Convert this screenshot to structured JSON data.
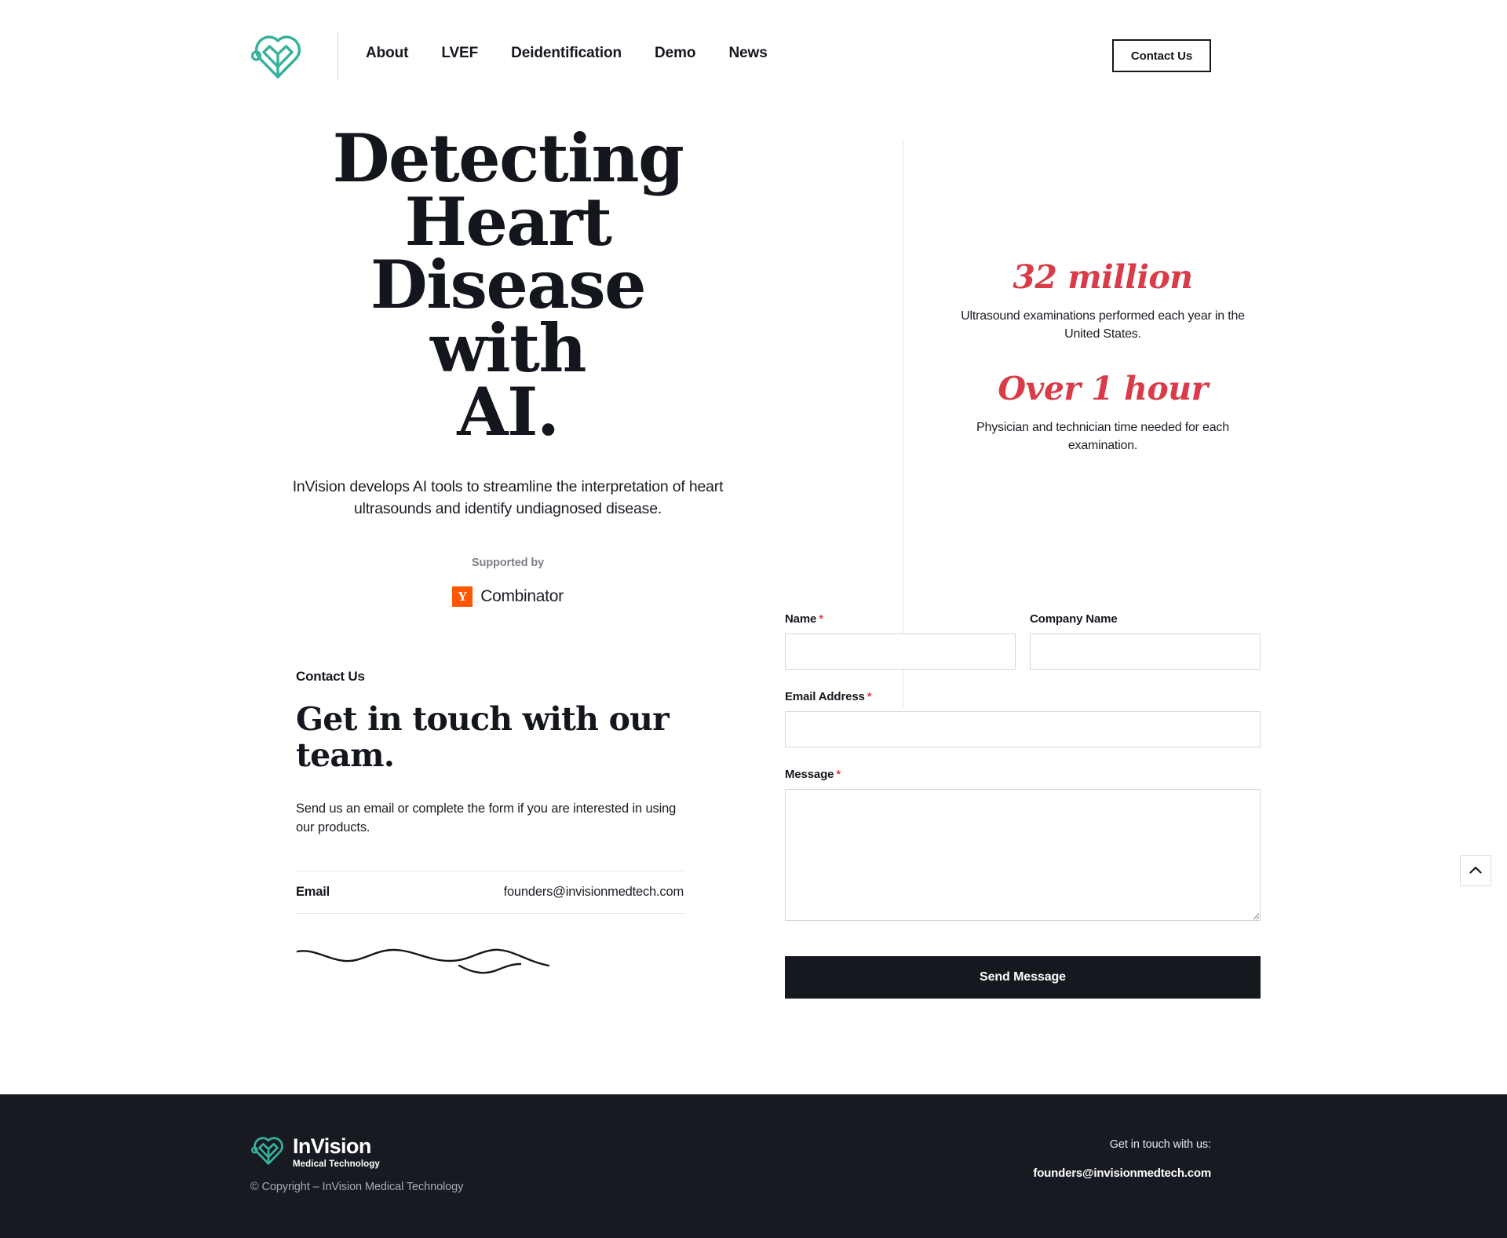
{
  "header": {
    "logo_name": "invision-heart-logo",
    "nav": [
      {
        "label": "About"
      },
      {
        "label": "LVEF"
      },
      {
        "label": "Deidentification"
      },
      {
        "label": "Demo"
      },
      {
        "label": "News"
      }
    ],
    "cta_label": "Contact Us"
  },
  "hero": {
    "title_lines": [
      "Detecting",
      "Heart",
      "Disease with",
      "AI."
    ],
    "subtitle": "InVision develops AI tools to streamline the interpretation of heart ultrasounds and identify undiagnosed disease.",
    "supported_by_label": "Supported by",
    "yc_mark": "Y",
    "yc_word": "Combinator",
    "stats": [
      {
        "value": "32 million",
        "description": "Ultrasound examinations performed each year in the United States."
      },
      {
        "value": "Over 1 hour",
        "description": "Physician and technician time needed for each examination."
      }
    ]
  },
  "contact": {
    "eyebrow": "Contact Us",
    "heading": "Get in touch with our team.",
    "body": "Send us an email or complete the form if you are interested in using our products.",
    "email_label": "Email",
    "email_value": "founders@invisionmedtech.com"
  },
  "form": {
    "name_label": "Name",
    "name_required": "*",
    "name_value": "",
    "company_label": "Company Name",
    "company_value": "",
    "email_label": "Email Address",
    "email_required": "*",
    "email_value": "",
    "message_label": "Message",
    "message_required": "*",
    "message_value": "",
    "submit_label": "Send Message"
  },
  "scroll_top": {
    "icon": "chevron-up-icon"
  },
  "footer": {
    "brand": "InVision",
    "tagline": "Medical Technology",
    "copyright": "© Copyright – InVision Medical Technology",
    "get_in_touch": "Get in touch with us:",
    "email": "founders@invisionmedtech.com"
  },
  "colors": {
    "teal": "#36B29C",
    "red_accent": "#D93B48",
    "yc_orange": "#FF5700",
    "ink": "#16181F",
    "footer_bg": "#181A22"
  }
}
